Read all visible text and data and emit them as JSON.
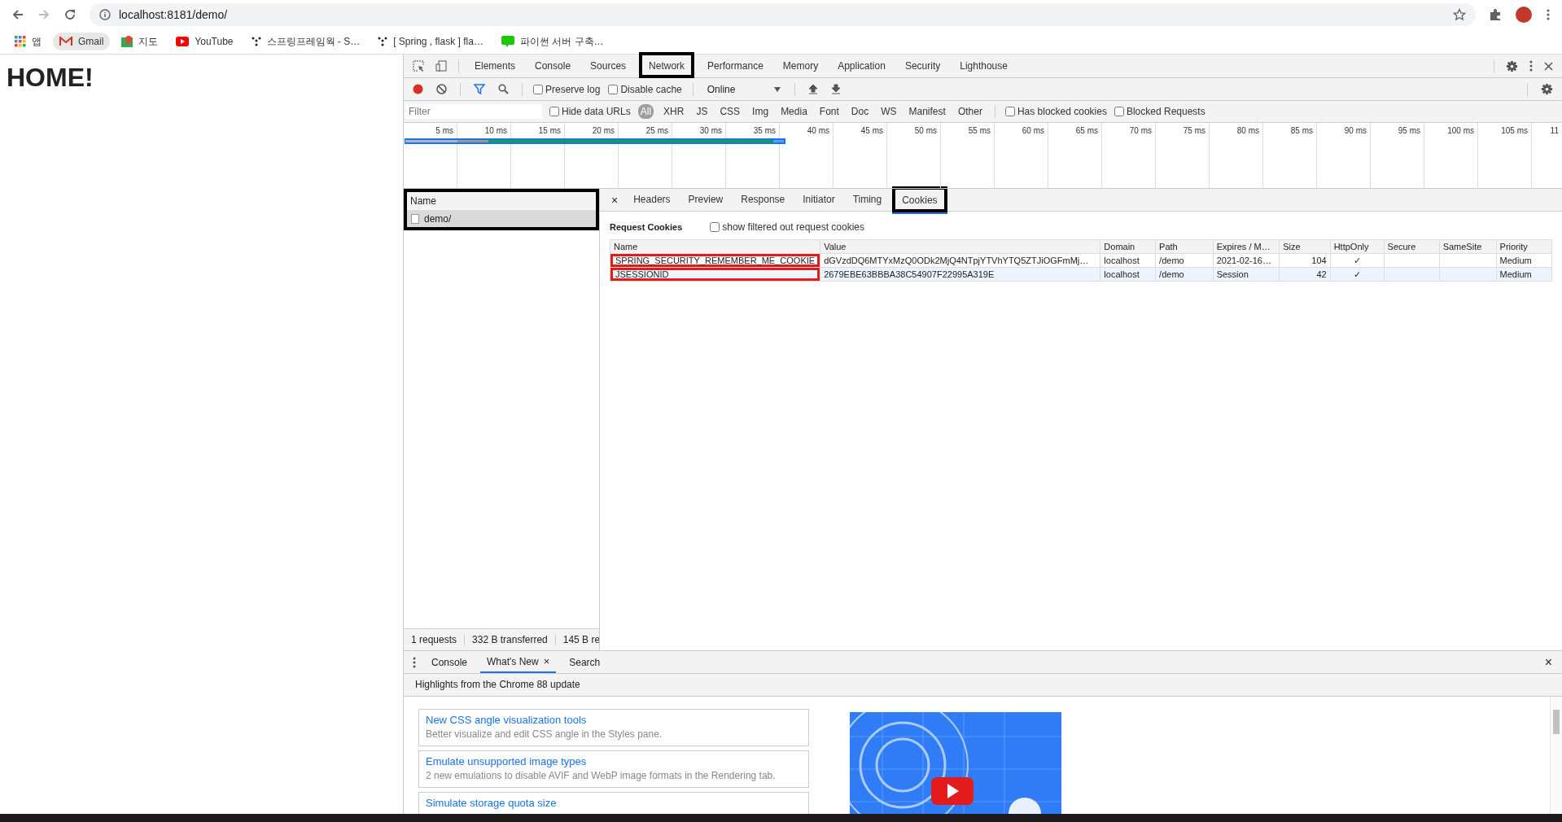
{
  "browser": {
    "url": "localhost:8181/demo/",
    "bookmarks": [
      {
        "label": "앱",
        "kind": "apps",
        "hovered": false
      },
      {
        "label": "Gmail",
        "kind": "gmail",
        "hovered": true
      },
      {
        "label": "지도",
        "kind": "maps",
        "hovered": false
      },
      {
        "label": "YouTube",
        "kind": "youtube",
        "hovered": false
      },
      {
        "label": "스프링프레임웍 - S…",
        "kind": "dots",
        "hovered": false
      },
      {
        "label": "[ Spring , flask ] fla…",
        "kind": "dots",
        "hovered": false
      },
      {
        "label": "파이썬 서버 구축…",
        "kind": "blog",
        "hovered": false
      }
    ]
  },
  "page": {
    "heading": "HOME!"
  },
  "devtools": {
    "tabs": [
      {
        "label": "Elements",
        "selected": false,
        "annotated": false
      },
      {
        "label": "Console",
        "selected": false,
        "annotated": false
      },
      {
        "label": "Sources",
        "selected": false,
        "annotated": false
      },
      {
        "label": "Network",
        "selected": true,
        "annotated": true
      },
      {
        "label": "Performance",
        "selected": false,
        "annotated": false
      },
      {
        "label": "Memory",
        "selected": false,
        "annotated": false
      },
      {
        "label": "Application",
        "selected": false,
        "annotated": false
      },
      {
        "label": "Security",
        "selected": false,
        "annotated": false
      },
      {
        "label": "Lighthouse",
        "selected": false,
        "annotated": false
      }
    ],
    "toolbar": {
      "recording": true,
      "preserve_log": {
        "label": "Preserve log",
        "checked": false
      },
      "disable_cache": {
        "label": "Disable cache",
        "checked": false
      },
      "throttle": "Online"
    },
    "filter": {
      "placeholder": "Filter",
      "hide_data_urls": {
        "label": "Hide data URLs",
        "checked": false
      },
      "types": [
        {
          "label": "All",
          "selected": true
        },
        {
          "label": "XHR",
          "selected": false
        },
        {
          "label": "JS",
          "selected": false
        },
        {
          "label": "CSS",
          "selected": false
        },
        {
          "label": "Img",
          "selected": false
        },
        {
          "label": "Media",
          "selected": false
        },
        {
          "label": "Font",
          "selected": false
        },
        {
          "label": "Doc",
          "selected": false
        },
        {
          "label": "WS",
          "selected": false
        },
        {
          "label": "Manifest",
          "selected": false
        },
        {
          "label": "Other",
          "selected": false
        }
      ],
      "has_blocked_cookies": {
        "label": "Has blocked cookies",
        "checked": false
      },
      "blocked_requests": {
        "label": "Blocked Requests",
        "checked": false
      }
    },
    "timeline": {
      "ticks": [
        "5 ms",
        "10 ms",
        "15 ms",
        "20 ms",
        "25 ms",
        "30 ms",
        "35 ms",
        "40 ms",
        "45 ms",
        "50 ms",
        "55 ms",
        "60 ms",
        "65 ms",
        "70 ms",
        "75 ms",
        "80 ms",
        "85 ms",
        "90 ms",
        "95 ms",
        "100 ms",
        "105 ms",
        "11"
      ]
    },
    "requests": {
      "header": "Name",
      "annotated": true,
      "rows": [
        {
          "name": "demo/",
          "selected": true
        }
      ],
      "status": [
        "1 requests",
        "332 B transferred",
        "145 B re"
      ]
    },
    "details": {
      "close": "×",
      "tabs": [
        {
          "label": "Headers",
          "selected": false,
          "annotated": false
        },
        {
          "label": "Preview",
          "selected": false,
          "annotated": false
        },
        {
          "label": "Response",
          "selected": false,
          "annotated": false
        },
        {
          "label": "Initiator",
          "selected": false,
          "annotated": false
        },
        {
          "label": "Timing",
          "selected": false,
          "annotated": false
        },
        {
          "label": "Cookies",
          "selected": true,
          "annotated": true
        }
      ],
      "section_title": "Request Cookies",
      "show_filtered": {
        "label": "show filtered out request cookies",
        "checked": false
      },
      "columns": [
        "Name",
        "Value",
        "Domain",
        "Path",
        "Expires / M…",
        "Size",
        "HttpOnly",
        "Secure",
        "SameSite",
        "Priority"
      ],
      "rows": [
        {
          "name": "SPRING_SECURITY_REMEMBER_ME_COOKIE",
          "value": "dGVzdDQ6MTYxMzQ0ODk2MjQ4NTpjYTVhYTQ5ZTJiOGFmMj…",
          "domain": "localhost",
          "path": "/demo",
          "expires": "2021-02-16…",
          "size": "104",
          "http_only": "✓",
          "priority": "Medium",
          "annotated": true,
          "hovered": false
        },
        {
          "name": "JSESSIONID",
          "value": "2679EBE63BBBA38C54907F22995A319E",
          "domain": "localhost",
          "path": "/demo",
          "expires": "Session",
          "size": "42",
          "http_only": "✓",
          "priority": "Medium",
          "annotated": true,
          "hovered": true
        }
      ]
    },
    "drawer": {
      "tabs": [
        {
          "label": "Console",
          "selected": false,
          "closable": false
        },
        {
          "label": "What's New",
          "selected": true,
          "closable": true
        },
        {
          "label": "Search",
          "selected": false,
          "closable": false
        }
      ],
      "close": "×",
      "tab_close": "×",
      "headline": "Highlights from the Chrome 88 update",
      "items": [
        {
          "title": "New CSS angle visualization tools",
          "description": "Better visualize and edit CSS angle in the Styles pane."
        },
        {
          "title": "Emulate unsupported image types",
          "description": "2 new emulations to disable AVIF and WebP image formats in the Rendering tab."
        },
        {
          "title": "Simulate storage quota size"
        }
      ]
    }
  }
}
